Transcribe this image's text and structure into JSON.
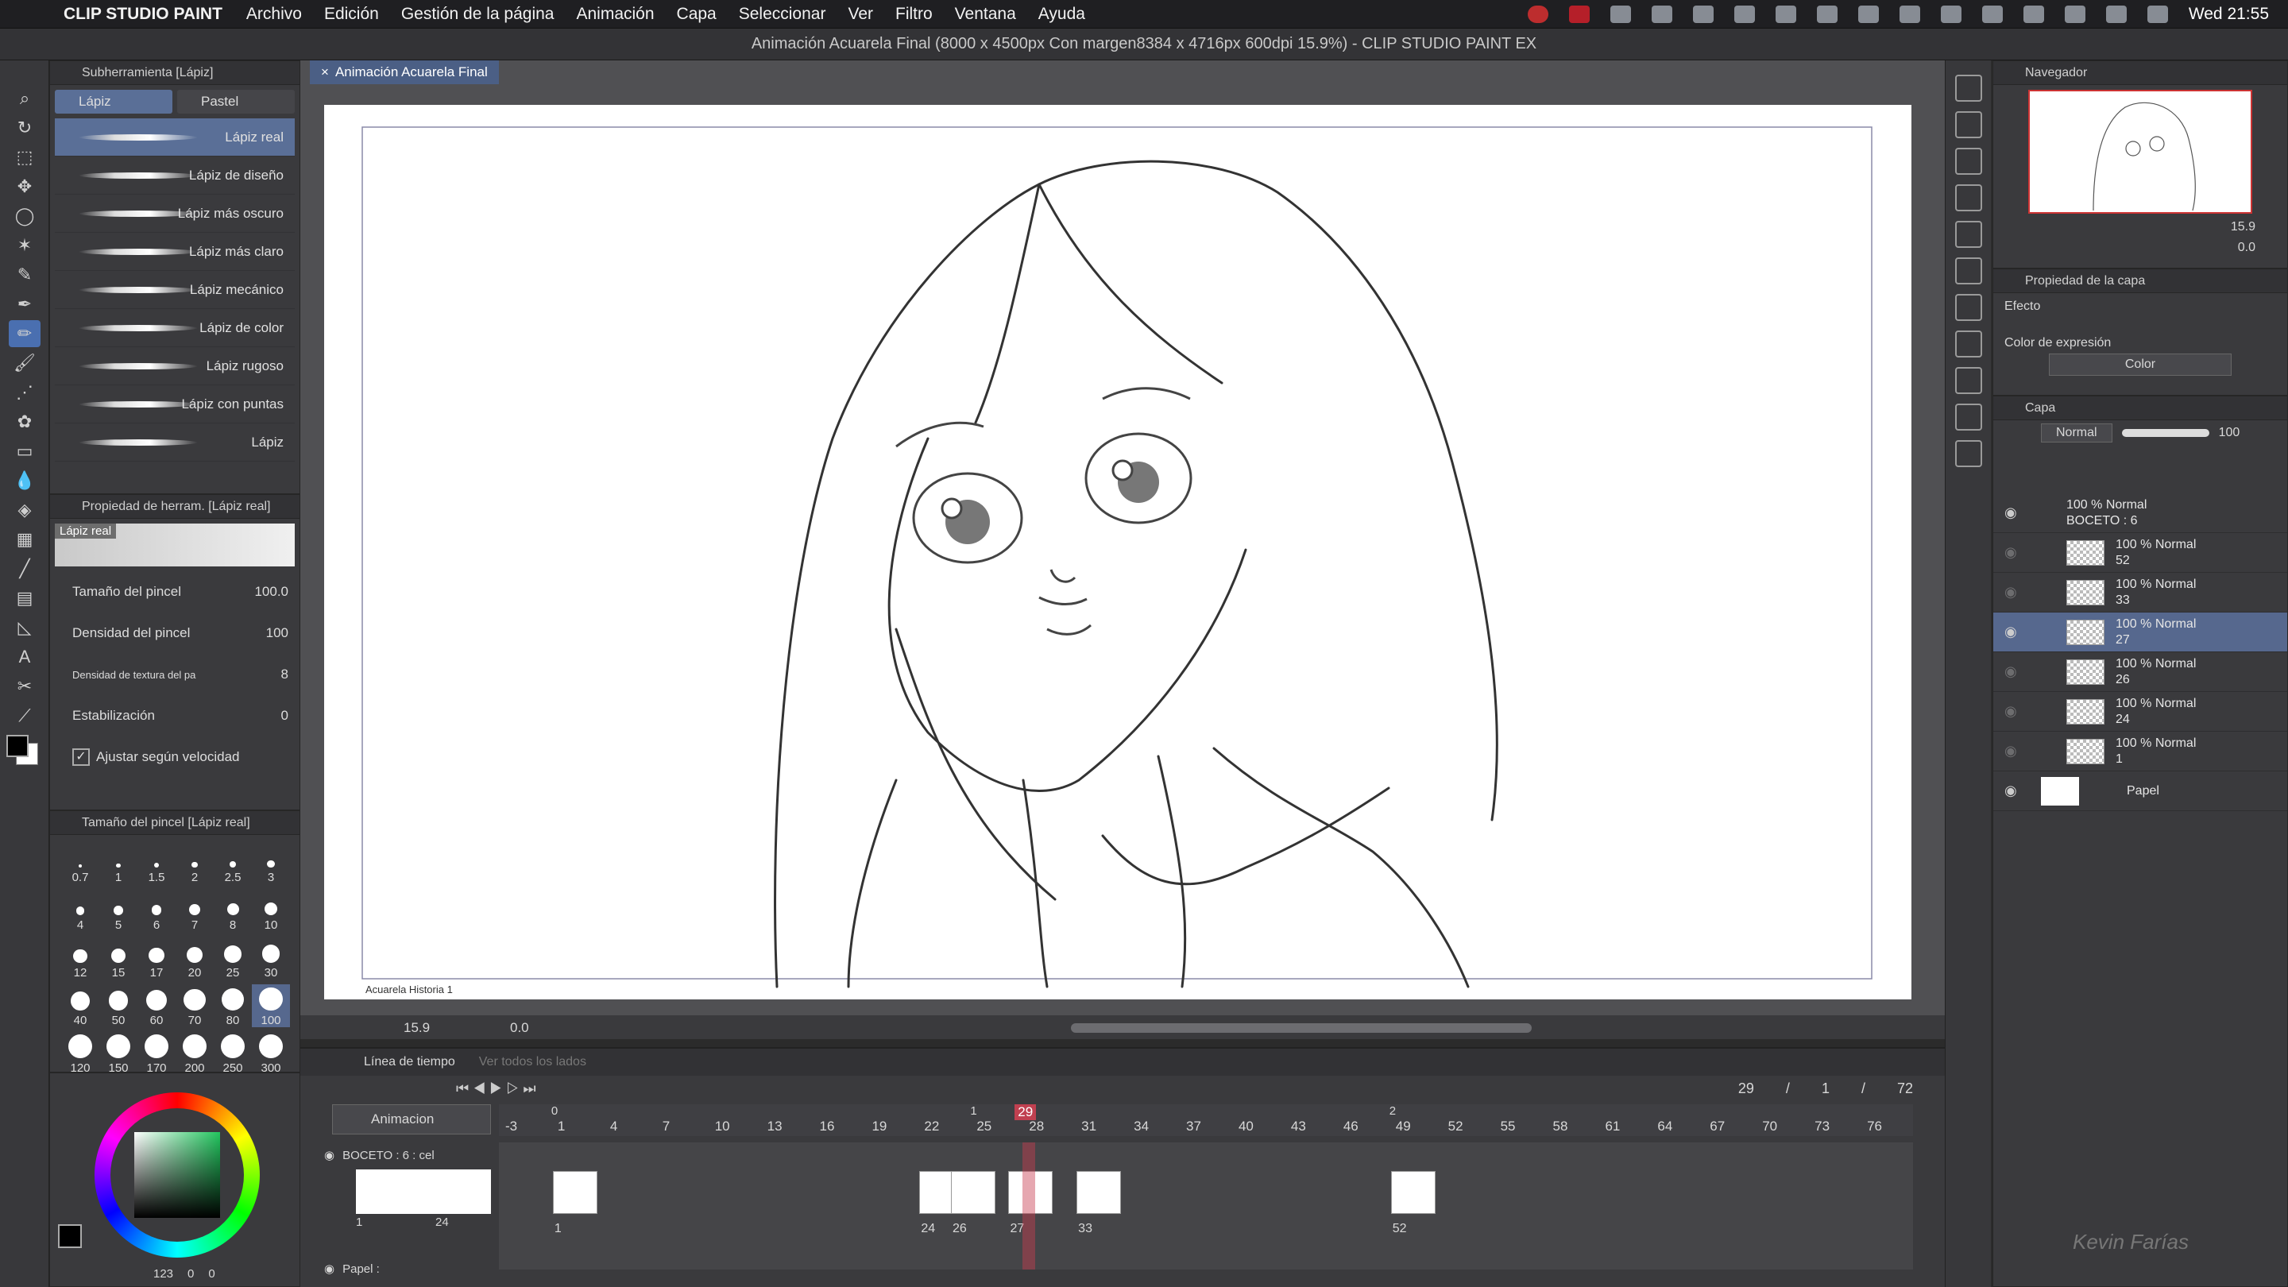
{
  "menubar": {
    "app": "CLIP STUDIO PAINT",
    "items": [
      "Archivo",
      "Edición",
      "Gestión de la página",
      "Animación",
      "Capa",
      "Seleccionar",
      "Ver",
      "Filtro",
      "Ventana",
      "Ayuda"
    ],
    "clock": "Wed 21:55"
  },
  "window": {
    "title": "Animación Acuarela Final (8000 x 4500px Con margen8384 x 4716px 600dpi 15.9%)  - CLIP STUDIO PAINT EX",
    "doc_tab": "Animación Acuarela Final"
  },
  "subtool": {
    "header": "Subherramienta [Lápiz]",
    "tabs": [
      "Lápiz",
      "Pastel"
    ],
    "brushes": [
      "Lápiz real",
      "Lápiz de diseño",
      "Lápiz más oscuro",
      "Lápiz más claro",
      "Lápiz mecánico",
      "Lápiz de color",
      "Lápiz rugoso",
      "Lápiz con puntas",
      "Lápiz"
    ]
  },
  "toolprop": {
    "header": "Propiedad de herram. [Lápiz real]",
    "preview_tag": "Lápiz real",
    "rows": [
      {
        "label": "Tamaño del pincel",
        "value": "100.0"
      },
      {
        "label": "Densidad del pincel",
        "value": "100"
      },
      {
        "label": "Densidad de textura del pa",
        "value": "8"
      },
      {
        "label": "Estabilización",
        "value": "0"
      }
    ],
    "checkbox": "Ajustar según velocidad"
  },
  "brushsize": {
    "header": "Tamaño del pincel [Lápiz real]",
    "sizes": [
      "0.7",
      "1",
      "1.5",
      "2",
      "2.5",
      "3",
      "4",
      "5",
      "6",
      "7",
      "8",
      "10",
      "12",
      "15",
      "17",
      "20",
      "25",
      "30",
      "40",
      "50",
      "60",
      "70",
      "80",
      "100",
      "120",
      "150",
      "170",
      "200",
      "250",
      "300"
    ],
    "selected": "100"
  },
  "color": {
    "readout": [
      "123",
      "0",
      "0"
    ],
    "main": "#000000",
    "sub": "#ffffff",
    "accent": "#4a6fb0"
  },
  "canvas": {
    "zoom": "15.9",
    "angle": "0.0",
    "caption": "Acuarela Historia 1"
  },
  "timeline": {
    "tabs": [
      "Línea de tiempo",
      "Ver todos los lados"
    ],
    "frame_counter": {
      "current": "29",
      "sep1": "/",
      "start": "1",
      "sep2": "/",
      "end": "72"
    },
    "anim_select": "Animacion",
    "track_boceto": "BOCETO : 6 : cel",
    "track_papel": "Papel :",
    "ruler_labels": [
      "-3",
      "1",
      "4",
      "7",
      "10",
      "13",
      "16",
      "19",
      "22",
      "25",
      "28",
      "31",
      "34",
      "37",
      "40",
      "43",
      "46",
      "49",
      "52",
      "55",
      "58",
      "61",
      "64",
      "67",
      "70",
      "73",
      "76"
    ],
    "marker_labels": [
      "0",
      "1",
      "2"
    ],
    "current_frame": "29",
    "thumb_frames": [
      "1",
      "24"
    ],
    "cel_labels": [
      "1",
      "24",
      "26",
      "27",
      "33",
      "52"
    ]
  },
  "navigator": {
    "header": "Navegador",
    "zoom": "15.9",
    "angle": "0.0"
  },
  "layerprop": {
    "header": "Propiedad de la capa",
    "effect": "Efecto",
    "expr_label": "Color de expresión",
    "expr_value": "Color"
  },
  "layers": {
    "header": "Capa",
    "blend": "Normal",
    "opacity": "100",
    "folder": {
      "line1": "100 % Normal",
      "line2": "BOCETO : 6"
    },
    "items": [
      {
        "line1": "100 % Normal",
        "line2": "52"
      },
      {
        "line1": "100 % Normal",
        "line2": "33"
      },
      {
        "line1": "100 % Normal",
        "line2": "27",
        "selected": true
      },
      {
        "line1": "100 % Normal",
        "line2": "26"
      },
      {
        "line1": "100 % Normal",
        "line2": "24"
      },
      {
        "line1": "100 % Normal",
        "line2": "1"
      }
    ],
    "paper": "Papel"
  },
  "watermark": "Kevin Farías"
}
